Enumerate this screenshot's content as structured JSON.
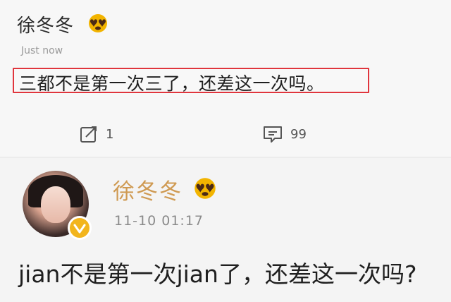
{
  "post": {
    "author": "徐冬冬",
    "author_emoji": "smiling-face-with-heart-eyes-emoji",
    "time": "Just now",
    "text": "三都不是第一次三了，还差这一次吗。",
    "actions": {
      "repost_icon": "repost-icon",
      "repost_count": "1",
      "comment_icon": "comment-icon",
      "comment_count": "99"
    }
  },
  "reply": {
    "author": "徐冬冬",
    "author_emoji": "smiling-face-with-heart-eyes-emoji",
    "avatar": "avatar",
    "verified_icon": "verified-badge-icon",
    "time": "11-10 01:17",
    "text": "jian不是第一次jian了，还差这一次吗?"
  },
  "colors": {
    "highlight_border": "#e0353d",
    "author_gold": "#cf9a52",
    "badge_gold": "#f2b51d"
  }
}
